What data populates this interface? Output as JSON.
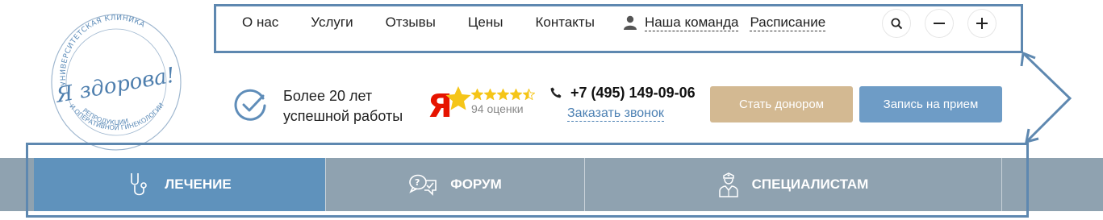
{
  "logo": {
    "arc_top": "УНИВЕРСИТЕТСКАЯ КЛИНИКА",
    "script_text": "Я здорова!",
    "arc_bottom_1": "РЕПРОДУКЦИИ",
    "arc_bottom_2": "И ОПЕРАТИВНОЙ ГИНЕКОЛОГИИ"
  },
  "top_nav": {
    "items": [
      {
        "label": "О нас"
      },
      {
        "label": "Услуги"
      },
      {
        "label": "Отзывы"
      },
      {
        "label": "Цены"
      },
      {
        "label": "Контакты"
      }
    ],
    "team_label": "Наша команда",
    "schedule_label": "Расписание",
    "icons": [
      "search-icon",
      "minus-icon",
      "plus-icon"
    ]
  },
  "experience": {
    "line1": "Более 20 лет",
    "line2": "успешной работы"
  },
  "rating": {
    "provider_letter": "Я",
    "stars": 4.5,
    "count_text": "94 оценки"
  },
  "contact": {
    "phone": "+7 (495) 149-09-06",
    "callback_label": "Заказать звонок"
  },
  "buttons": {
    "donor": "Стать донором",
    "appointment": "Запись на прием"
  },
  "main_menu": {
    "items": [
      {
        "label": "ЛЕЧЕНИЕ",
        "icon": "stethoscope-icon",
        "active": true
      },
      {
        "label": "ФОРУМ",
        "icon": "chat-bubbles-icon",
        "active": false
      },
      {
        "label": "СПЕЦИАЛИСТАМ",
        "icon": "doctor-icon",
        "active": false
      }
    ]
  },
  "colors": {
    "accent_blue": "#6e9cc6",
    "active_tab": "#5f92bc",
    "menu_bar": "#8fa2b0",
    "donor_button": "#d3b992",
    "star_yellow": "#f5c518",
    "yandex_red": "#e61400",
    "annotation": "#5e88b0"
  }
}
